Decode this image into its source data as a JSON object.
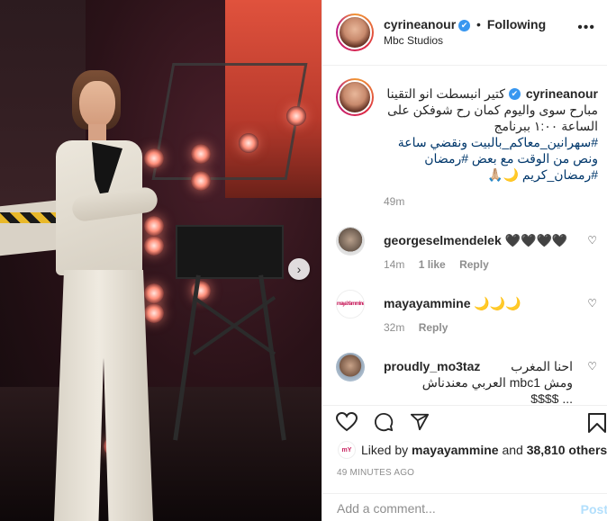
{
  "post": {
    "username": "cyrineanour",
    "follow_status": "Following",
    "location": "Mbc Studios",
    "caption_lines": [
      "كتير انبسطت انو التقينا",
      "مبارح سوى واليوم كمان رح شوفكن على",
      "الساعة ١:٠٠ ببرنامج",
      "#سهرانين_معاكم_بالبيت ونقضي ساعة",
      "ونص من الوقت مع بعض #رمضان",
      "#رمضان_كريم 🌙🙏🏼"
    ],
    "caption_time": "49m"
  },
  "comments": [
    {
      "username": "georgeselmendelek",
      "text": "🖤🖤🖤🖤",
      "time": "14m",
      "likes": "1 like",
      "reply": "Reply"
    },
    {
      "username": "mayayammine",
      "avatar_text": "mayaYammine",
      "text": "🌙🌙🌙",
      "time": "32m",
      "reply": "Reply"
    },
    {
      "username": "proudly_mo3taz",
      "text_line1": "احنا المغرب",
      "text_line2": "ومش mbc1 العربي معندناش",
      "text_line3": "... $$$$"
    }
  ],
  "likes": {
    "prefix": "Liked by",
    "user": "mayayammine",
    "middle": "and",
    "count": "38,810 others"
  },
  "post_time": "49 MINUTES AGO",
  "add_comment": {
    "placeholder": "Add a comment...",
    "post_label": "Post"
  },
  "icons": {
    "verified": "✔",
    "more": "•••",
    "heart": "♡",
    "comment": "◯",
    "share": "➤",
    "bookmark": "▯",
    "next": "›"
  },
  "colors": {
    "accent_blue": "#3897f0",
    "hashtag": "#00376b",
    "muted": "#8e8e8e",
    "post_button_disabled": "#b2dffc"
  }
}
